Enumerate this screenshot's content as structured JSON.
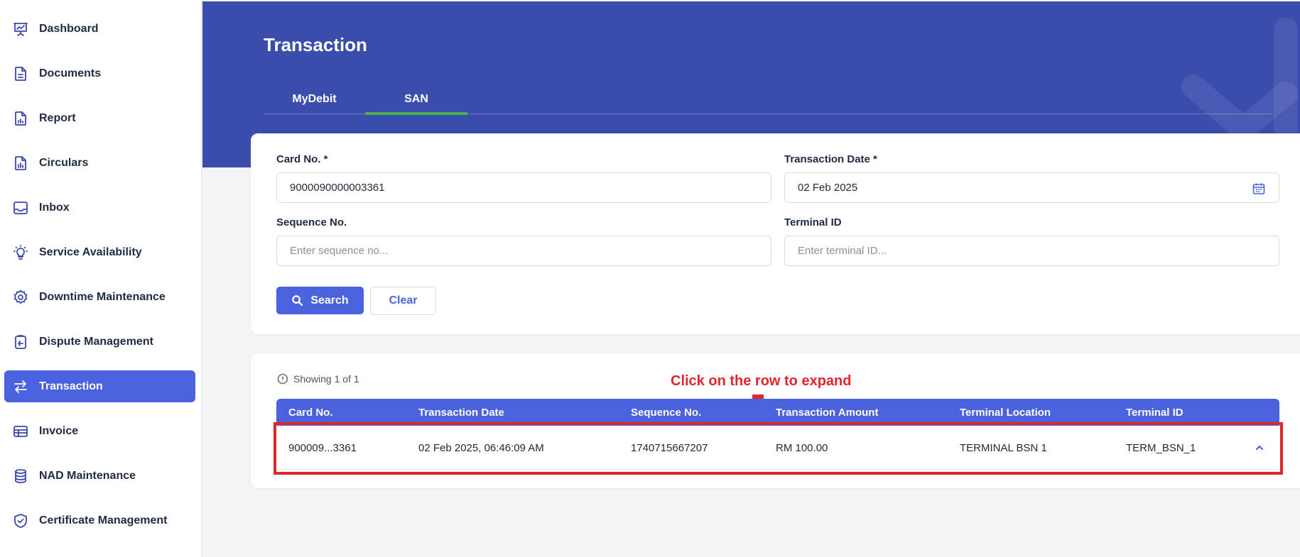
{
  "sidebar": {
    "items": [
      {
        "label": "Dashboard",
        "icon": "presentation-chart-icon",
        "active": false
      },
      {
        "label": "Documents",
        "icon": "document-icon",
        "active": false
      },
      {
        "label": "Report",
        "icon": "report-chart-icon",
        "active": false
      },
      {
        "label": "Circulars",
        "icon": "circulars-icon",
        "active": false
      },
      {
        "label": "Inbox",
        "icon": "inbox-icon",
        "active": false
      },
      {
        "label": "Service Availability",
        "icon": "lightbulb-icon",
        "active": false
      },
      {
        "label": "Downtime Maintenance",
        "icon": "gear-icon",
        "active": false
      },
      {
        "label": "Dispute Management",
        "icon": "clipboard-icon",
        "active": false
      },
      {
        "label": "Transaction",
        "icon": "arrows-swap-icon",
        "active": true
      },
      {
        "label": "Invoice",
        "icon": "invoice-table-icon",
        "active": false
      },
      {
        "label": "NAD Maintenance",
        "icon": "database-icon",
        "active": false
      },
      {
        "label": "Certificate Management",
        "icon": "shield-check-icon",
        "active": false
      }
    ]
  },
  "header": {
    "title": "Transaction",
    "tabs": [
      {
        "label": "MyDebit",
        "active": false
      },
      {
        "label": "SAN",
        "active": true
      }
    ]
  },
  "form": {
    "card_no": {
      "label": "Card No. *",
      "value": "9000090000003361"
    },
    "transaction_date": {
      "label": "Transaction Date *",
      "value": "02 Feb 2025"
    },
    "sequence_no": {
      "label": "Sequence No.",
      "placeholder": "Enter sequence no..."
    },
    "terminal_id": {
      "label": "Terminal ID",
      "placeholder": "Enter terminal ID..."
    },
    "search_label": "Search",
    "clear_label": "Clear"
  },
  "results": {
    "showing_text": "Showing 1 of 1",
    "annotation": "Click on the row to expand",
    "columns": [
      "Card No.",
      "Transaction Date",
      "Sequence No.",
      "Transaction Amount",
      "Terminal Location",
      "Terminal ID"
    ],
    "rows": [
      {
        "card_no": "900009...3361",
        "transaction_date": "02 Feb 2025, 06:46:09 AM",
        "sequence_no": "1740715667207",
        "amount": "RM 100.00",
        "terminal_location": "TERMINAL BSN 1",
        "terminal_id": "TERM_BSN_1"
      }
    ]
  },
  "colors": {
    "primary": "#4a62dd",
    "header_band": "#3a4dac",
    "tab_underline": "#4caf50",
    "annotation_red": "#e0262d"
  }
}
